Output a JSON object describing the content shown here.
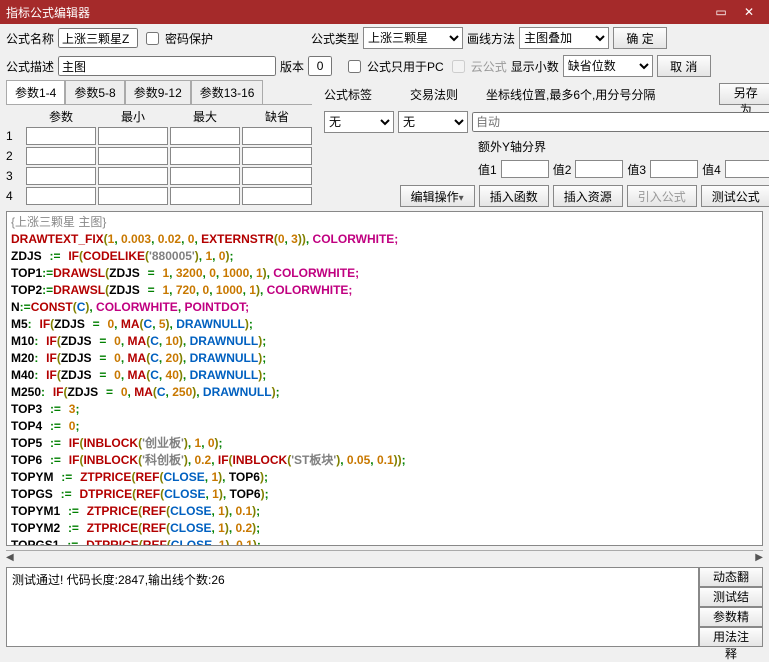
{
  "title": "指标公式编辑器",
  "header": {
    "nameLabel": "公式名称",
    "nameValue": "上涨三颗星Z",
    "pwdProtect": "密码保护",
    "typeLabel": "公式类型",
    "typeValue": "上涨三颗星",
    "lineMethodLabel": "画线方法",
    "lineMethodValue": "主图叠加",
    "okBtn": "确 定",
    "descLabel": "公式描述",
    "descValue": "主图",
    "versionLabel": "版本",
    "versionValue": "0",
    "onlyPC": "公式只用于PC",
    "cloud": "云公式",
    "showDecimalLabel": "显示小数",
    "showDecimalValue": "缺省位数",
    "cancelBtn": "取 消"
  },
  "paramTabs": [
    "参数1-4",
    "参数5-8",
    "参数9-12",
    "参数13-16"
  ],
  "paramHeaders": [
    "参数",
    "最小",
    "最大",
    "缺省"
  ],
  "paramRows": [
    "1",
    "2",
    "3",
    "4"
  ],
  "right": {
    "tagLabel": "公式标签",
    "tagValue": "无",
    "ruleLabel": "交易法则",
    "ruleValue": "无",
    "coordLabel": "坐标线位置,最多6个,用分号分隔",
    "autoPlaceholder": "自动",
    "extraYLabel": "额外Y轴分界",
    "valLabels": [
      "值1",
      "值2",
      "值3",
      "值4"
    ],
    "saveAsBtn": "另存为"
  },
  "toolbar": {
    "editOp": "编辑操作",
    "insertFn": "插入函数",
    "insertRes": "插入资源",
    "importFormula": "引入公式",
    "testFormula": "测试公式"
  },
  "codeTitle": "{上涨三颗星 主图}",
  "status": "测试通过! 代码长度:2847,输出线个数:26",
  "sideBtns": [
    "动态翻译",
    "测试结果",
    "参数精灵",
    "用法注释"
  ]
}
